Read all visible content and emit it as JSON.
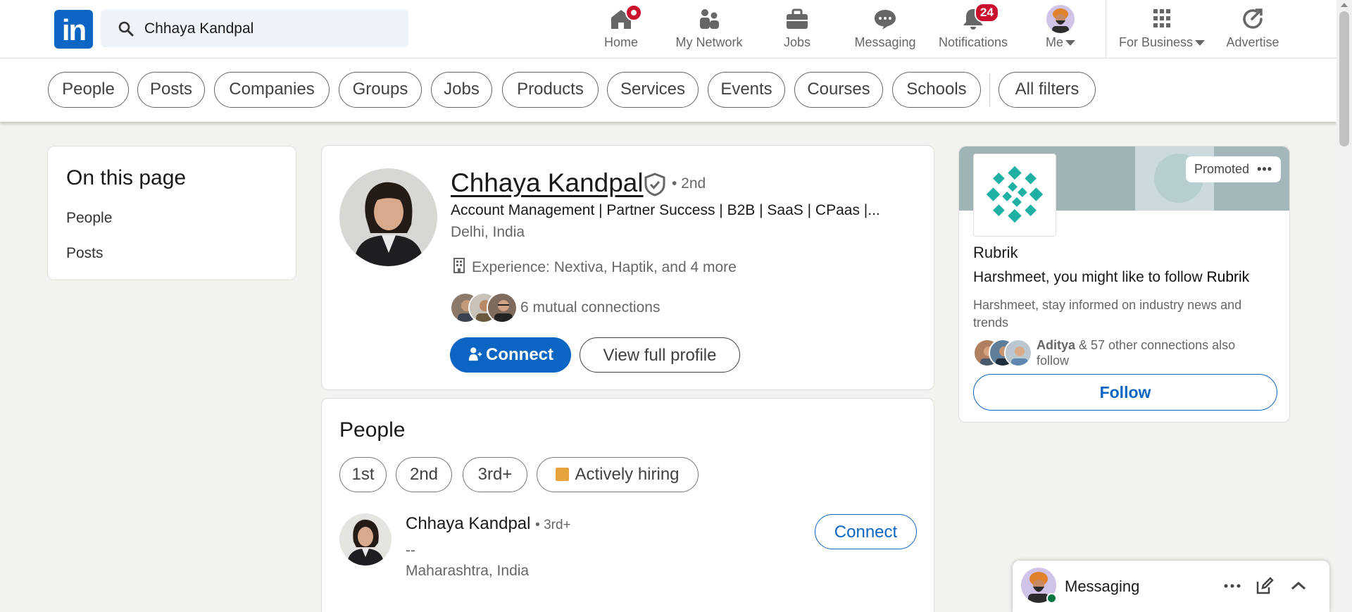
{
  "search": {
    "value": "Chhaya Kandpal"
  },
  "nav": {
    "home": "Home",
    "network": "My Network",
    "jobs": "Jobs",
    "messaging": "Messaging",
    "notifications": "Notifications",
    "notifications_count": "24",
    "me": "Me",
    "business": "For Business",
    "advertise": "Advertise"
  },
  "filters": [
    "People",
    "Posts",
    "Companies",
    "Groups",
    "Jobs",
    "Products",
    "Services",
    "Events",
    "Courses",
    "Schools",
    "All filters"
  ],
  "on_this_page": {
    "title": "On this page",
    "links": [
      "People",
      "Posts"
    ]
  },
  "profile": {
    "name": "Chhaya Kandpal",
    "degree": "• 2nd",
    "headline": "Account Management | Partner Success | B2B | SaaS | CPaas |...",
    "location": "Delhi, India",
    "experience": "Experience: Nextiva, Haptik, and 4 more",
    "mutual": "6 mutual connections",
    "connect": "Connect",
    "view_profile": "View full profile"
  },
  "people": {
    "title": "People",
    "filters": [
      "1st",
      "2nd",
      "3rd+",
      "Actively hiring"
    ],
    "result": {
      "name": "Chhaya Kandpal",
      "degree": "• 3rd+",
      "subtitle": "--",
      "location": "Maharashtra, India",
      "connect": "Connect"
    }
  },
  "ad": {
    "promoted": "Promoted",
    "company": "Rubrik",
    "message_prefix": "Harshmeet, you might like to follow ",
    "message_company": "Rubrik",
    "subtitle": "Harshmeet, stay informed on industry news and trends",
    "connections_name": "Aditya",
    "connections_rest": " & 57 other connections also follow",
    "follow": "Follow"
  },
  "messaging": {
    "label": "Messaging"
  },
  "colors": {
    "brand": "#0a66c2",
    "badge": "#cb112d",
    "ad_logo": "#1fb0a4"
  }
}
